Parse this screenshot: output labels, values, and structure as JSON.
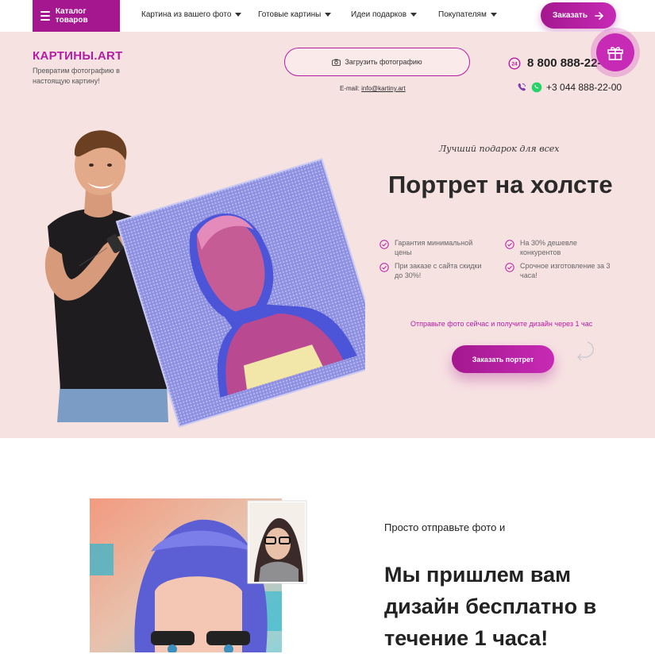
{
  "nav": {
    "catalog_label": "Каталог товаров",
    "items": [
      {
        "label": "Картина из вашего фото"
      },
      {
        "label": "Готовые картины"
      },
      {
        "label": "Идеи подарков"
      },
      {
        "label": "Покупателям"
      }
    ],
    "order_label": "Заказать"
  },
  "header": {
    "logo": "КАРТИНЫ.ART",
    "tagline": "Превратим фотографию в настоящую картину!",
    "upload_label": "Загрузить фотографию",
    "email_label": "E-mail:",
    "email": "info@kartiny.art",
    "phone_main": "8 800 888-22-00",
    "phone_alt": "+3 044 888-22-00",
    "badge_24": "24"
  },
  "hero": {
    "subtitle": "Лучший подарок для всех",
    "title": "Портрет на холсте",
    "features": [
      "Гарантия минимальной цены",
      "На 30% дешевле конкурентов",
      "При заказе с сайта скидки до 30%!",
      "Срочное изготовление за 3 часа!"
    ],
    "send_note": "Отправьте фото сейчас и получите дизайн через 1 час",
    "cta": "Заказать портрет"
  },
  "section2": {
    "lead": "Просто отправьте фото и",
    "title": "Мы пришлем вам дизайн бесплатно в течение 1 часа!"
  },
  "colors": {
    "brand": "#b31da3",
    "brand_dark": "#a4178f",
    "hero_bg": "#f7e2e2",
    "whatsapp": "#25d366"
  },
  "icons": [
    "menu-icon",
    "caret-down-icon",
    "arrow-right-icon",
    "camera-icon",
    "phone-24-icon",
    "viber-icon",
    "whatsapp-icon",
    "gift-icon",
    "check-icon",
    "curved-arrow-icon"
  ]
}
